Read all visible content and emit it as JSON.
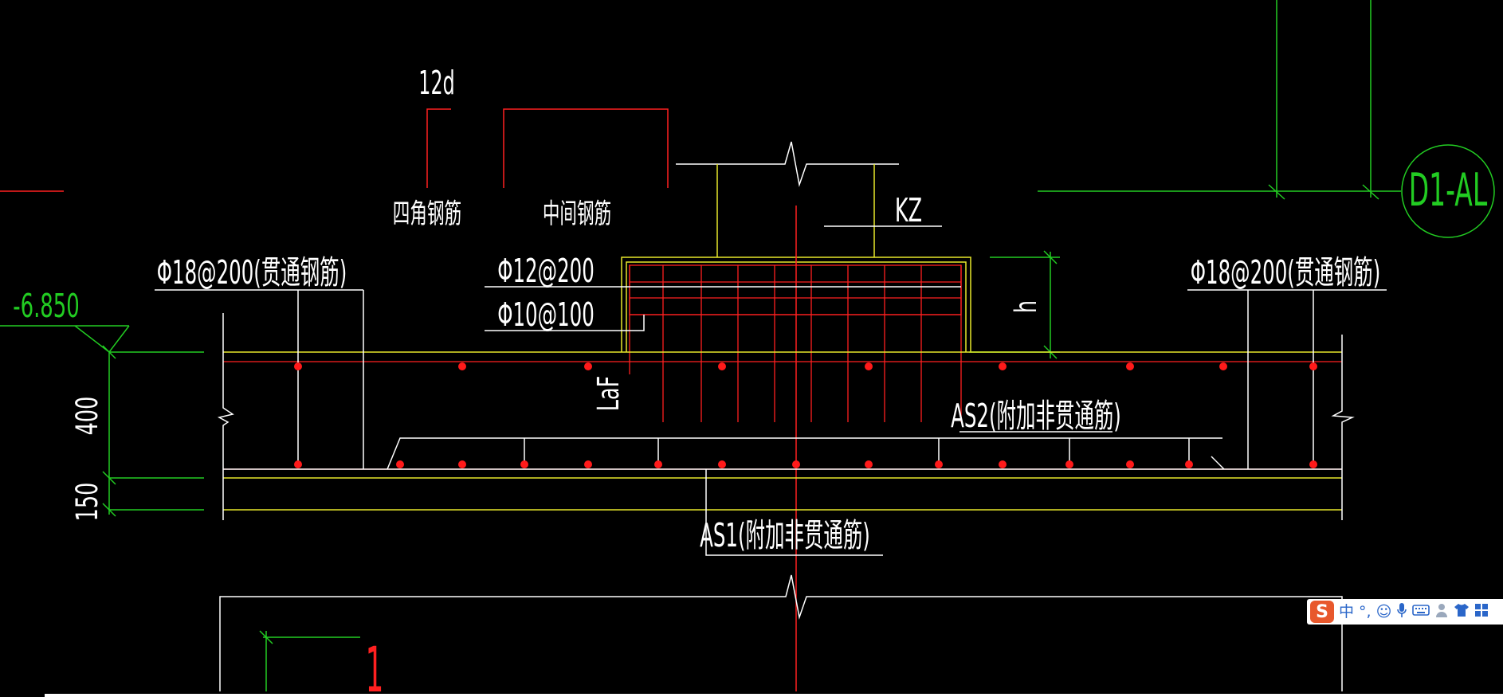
{
  "drawing": {
    "label_12d": "12d",
    "label_corner_bars": "四角钢筋",
    "label_middle_bars": "中间钢筋",
    "label_kz": "KZ",
    "label_top_left_rebar": "Φ18@200(贯通钢筋)",
    "label_top_right_rebar": "Φ18@200(贯通钢筋)",
    "label_phi12": "Φ12@200",
    "label_phi10": "Φ10@100",
    "label_h": "h",
    "label_laf": "LaF",
    "label_as2": "AS2(附加非贯通筋)",
    "label_as1": "AS1(附加非贯通筋)",
    "label_elevation": "-6.850",
    "label_dim_400": "400",
    "label_dim_150": "150",
    "label_axis": "D1-AL",
    "label_one": "1"
  },
  "colors": {
    "background": "#000000",
    "white_line": "#ffffff",
    "red_line": "#ff2020",
    "yellow_line": "#e8e82a",
    "green_line": "#22cc22",
    "rebar_dot": "#ff1a1a"
  },
  "ime_toolbar": {
    "logo": "S",
    "mode": "中",
    "punct": "°,",
    "emoji_icon": "smile-icon",
    "mic_icon": "microphone-icon",
    "keyboard_icon": "keyboard-icon",
    "user_icon": "user-icon",
    "shirt_icon": "shirt-icon",
    "grid_icon": "grid-icon"
  }
}
